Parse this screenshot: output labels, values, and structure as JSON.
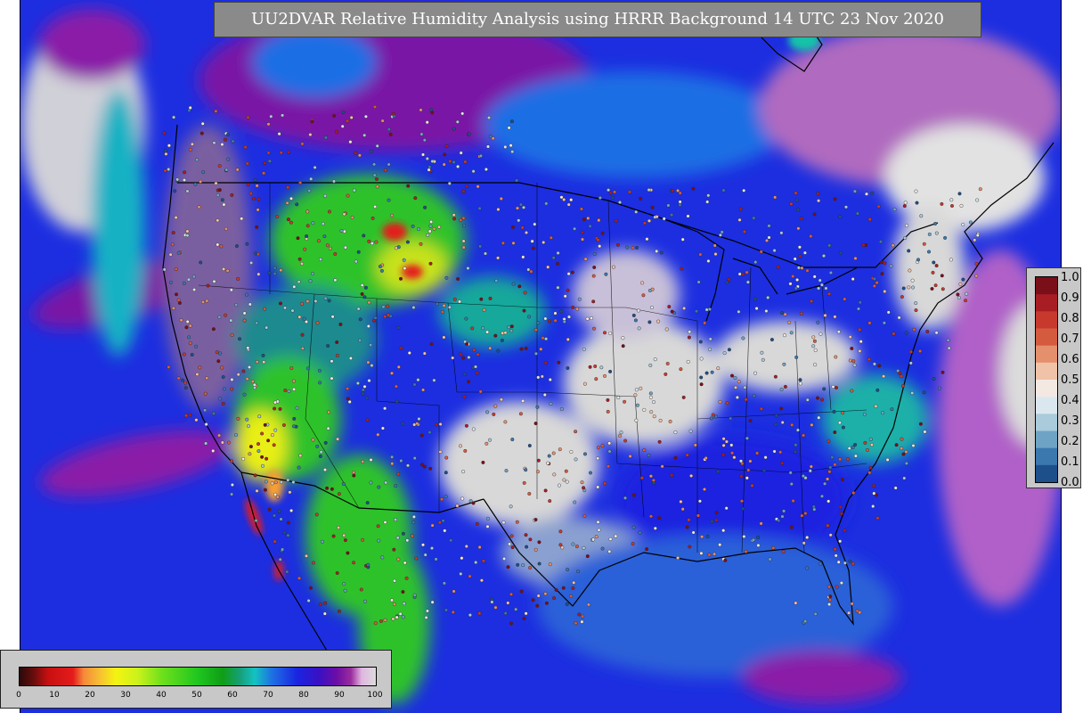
{
  "title": "UU2DVAR Relative Humidity Analysis using HRRR Background 14 UTC 23 Nov 2020",
  "map": {
    "layer": "relative-humidity-field",
    "overlays": [
      "state-borders",
      "country-borders",
      "coastlines",
      "observation-stations"
    ]
  },
  "obs_legend": {
    "labels": [
      "1.0",
      "0.9",
      "0.8",
      "0.7",
      "0.6",
      "0.5",
      "0.4",
      "0.3",
      "0.2",
      "0.1",
      "0.0"
    ],
    "colors": [
      "#7a0f19",
      "#a81d24",
      "#c7392d",
      "#d55b3e",
      "#e4906d",
      "#f0c2a8",
      "#f3e9e2",
      "#dbe7ee",
      "#a9cbdb",
      "#6ea3c6",
      "#3a78ae",
      "#1d4f8b"
    ]
  },
  "rh_colorbar": {
    "labels": [
      "0",
      "10",
      "20",
      "30",
      "40",
      "50",
      "60",
      "70",
      "80",
      "90",
      "100"
    ],
    "stops": [
      {
        "v": 0,
        "c": "#2a0a0a"
      },
      {
        "v": 4,
        "c": "#6a0d0d"
      },
      {
        "v": 8,
        "c": "#c80f10"
      },
      {
        "v": 15,
        "c": "#e41c1c"
      },
      {
        "v": 18,
        "c": "#f58a3a"
      },
      {
        "v": 23,
        "c": "#f7c531"
      },
      {
        "v": 27,
        "c": "#f4f410"
      },
      {
        "v": 33,
        "c": "#cdf21b"
      },
      {
        "v": 40,
        "c": "#6ee01c"
      },
      {
        "v": 50,
        "c": "#1fc71f"
      },
      {
        "v": 57,
        "c": "#0f9d16"
      },
      {
        "v": 62,
        "c": "#17a07a"
      },
      {
        "v": 66,
        "c": "#14c2c2"
      },
      {
        "v": 71,
        "c": "#1e6ee4"
      },
      {
        "v": 78,
        "c": "#1a24e0"
      },
      {
        "v": 84,
        "c": "#3a10c4"
      },
      {
        "v": 89,
        "c": "#6b0ea6"
      },
      {
        "v": 93,
        "c": "#9a2c9e"
      },
      {
        "v": 96,
        "c": "#e0b6e0"
      },
      {
        "v": 100,
        "c": "#dcdcdc"
      }
    ]
  },
  "colors": {
    "ocean_blue": "#1c2ee0",
    "gulf_blue": "#2a60d8",
    "dry_white": "#d8d8d8",
    "purple": "#8a1fa8",
    "green": "#2fc22b",
    "yellow": "#e8ee12",
    "cyan": "#15b2c4"
  }
}
